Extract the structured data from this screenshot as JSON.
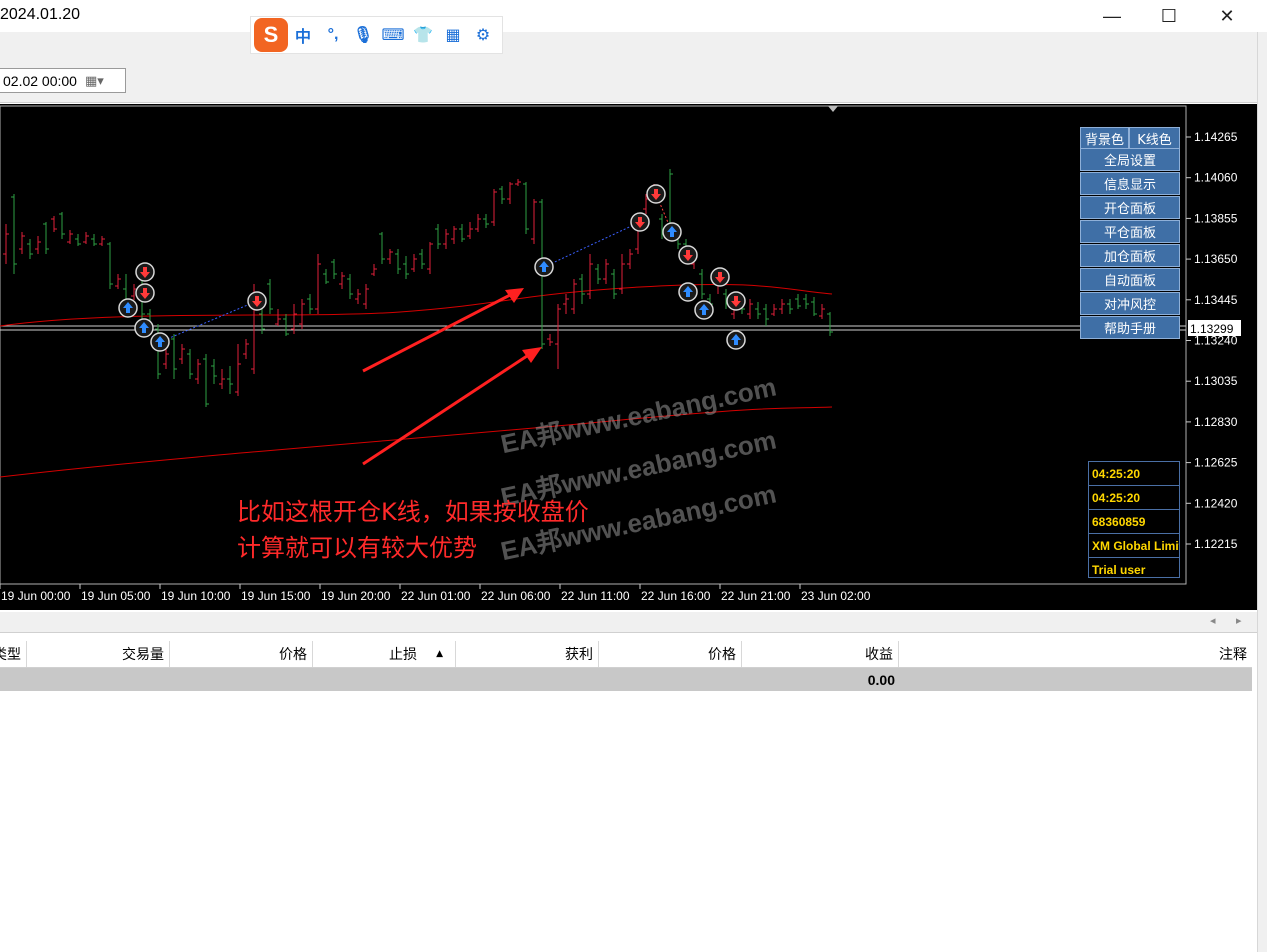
{
  "window": {
    "title": "2024.01.20",
    "minimize": "—",
    "maximize": "☐",
    "close": "✕"
  },
  "ime_toolbar": {
    "logo": "S",
    "mode": "中",
    "punct": "°,",
    "icons": [
      "microphone-icon",
      "keyboard-icon",
      "skin-icon",
      "grid-icon",
      "settings-icon"
    ]
  },
  "toolbar": {
    "date_value": "02.02 00:00"
  },
  "chart": {
    "price_ticks": [
      "1.14265",
      "1.14060",
      "1.13855",
      "1.13650",
      "1.13445",
      "1.13240",
      "1.13035",
      "1.12830",
      "1.12625",
      "1.12420",
      "1.12215"
    ],
    "current_price": "1.13299",
    "time_ticks": [
      "19 Jun 00:00",
      "19 Jun 05:00",
      "19 Jun 10:00",
      "19 Jun 15:00",
      "19 Jun 20:00",
      "22 Jun 01:00",
      "22 Jun 06:00",
      "22 Jun 11:00",
      "22 Jun 16:00",
      "22 Jun 21:00",
      "23 Jun 02:00"
    ],
    "colors": {
      "bull": "#2ea043",
      "bear": "#e0203a",
      "ma": "#d40000",
      "background": "#000000"
    }
  },
  "side_panel": {
    "top_left": "背景色",
    "top_right": "K线色",
    "buttons": [
      "全局设置",
      "信息显示",
      "开仓面板",
      "平仓面板",
      "加仓面板",
      "自动面板",
      "对冲风控",
      "帮助手册"
    ]
  },
  "info_panel": {
    "rows": [
      "04:25:20",
      "04:25:20",
      "68360859",
      "XM Global Limited",
      "Trial user"
    ]
  },
  "annotation": {
    "line1": "比如这根开仓K线，如果按收盘价",
    "line2": "计算就可以有较大优势"
  },
  "watermark": {
    "text1": "EA邦www.eabang.com",
    "text2": "EA邦www.eabang.com",
    "text3": "EA邦www.eabang.com"
  },
  "trade_table": {
    "headers": [
      "类型",
      "交易量",
      "价格",
      "止损",
      "获利",
      "价格",
      "收益",
      "注释"
    ],
    "profit_total": "0.00"
  }
}
